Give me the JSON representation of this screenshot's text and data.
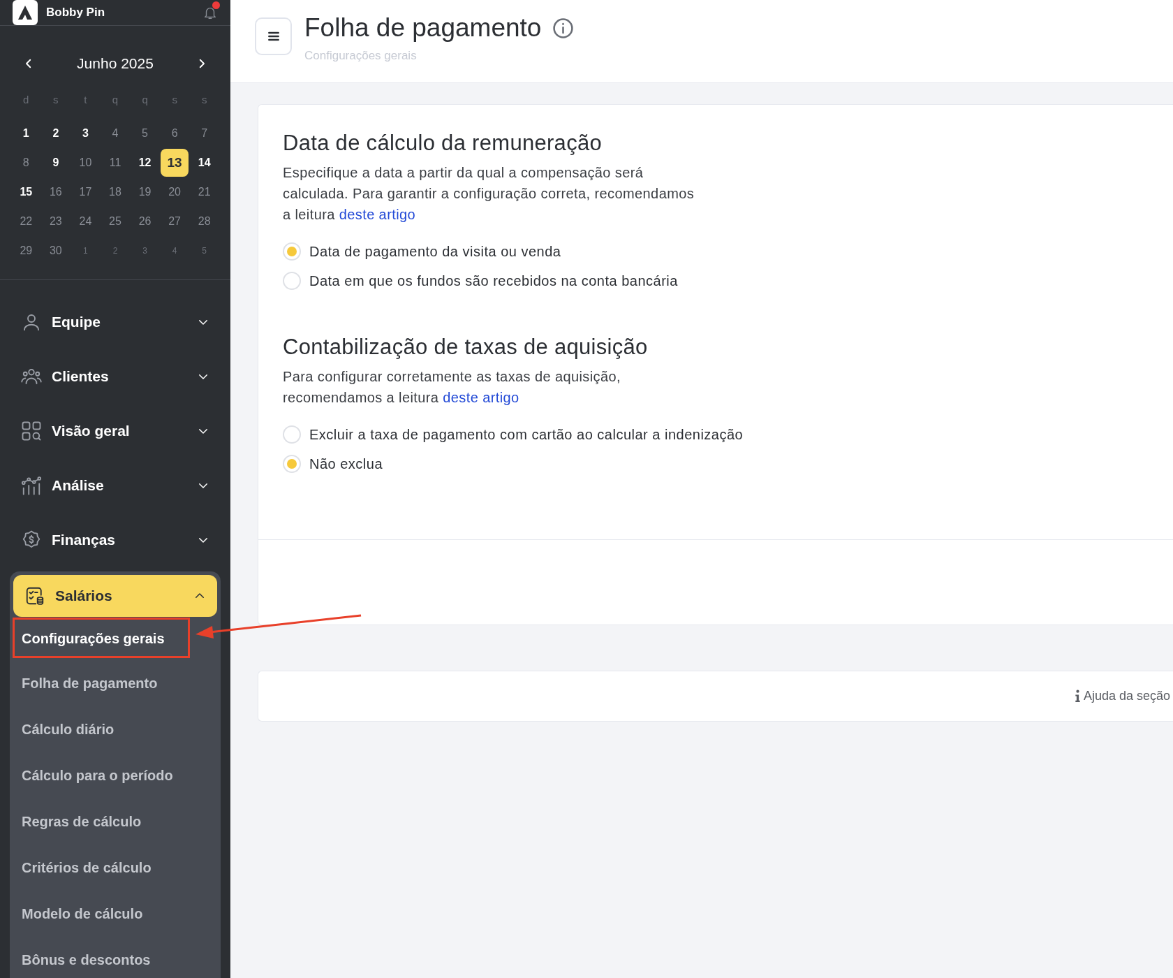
{
  "sidebar": {
    "user": {
      "name": "Bobby Pin",
      "has_notification": true
    },
    "calendar": {
      "month": "Junho 2025",
      "weekdays": [
        "d",
        "s",
        "t",
        "q",
        "q",
        "s",
        "s"
      ],
      "weeks": [
        [
          {
            "day": "1",
            "kind": "bold",
            "selected": false
          },
          {
            "day": "2",
            "kind": "bold",
            "selected": false
          },
          {
            "day": "3",
            "kind": "bold",
            "selected": false
          },
          {
            "day": "4",
            "kind": "normal",
            "selected": false
          },
          {
            "day": "5",
            "kind": "normal",
            "selected": false
          },
          {
            "day": "6",
            "kind": "normal",
            "selected": false
          },
          {
            "day": "7",
            "kind": "normal",
            "selected": false
          }
        ],
        [
          {
            "day": "8",
            "kind": "normal",
            "selected": false
          },
          {
            "day": "9",
            "kind": "bold",
            "selected": false
          },
          {
            "day": "10",
            "kind": "normal",
            "selected": false
          },
          {
            "day": "11",
            "kind": "normal",
            "selected": false
          },
          {
            "day": "12",
            "kind": "bold",
            "selected": false
          },
          {
            "day": "13",
            "kind": "bold",
            "selected": true
          },
          {
            "day": "14",
            "kind": "bold",
            "selected": false
          }
        ],
        [
          {
            "day": "15",
            "kind": "bold",
            "selected": false
          },
          {
            "day": "16",
            "kind": "normal",
            "selected": false
          },
          {
            "day": "17",
            "kind": "normal",
            "selected": false
          },
          {
            "day": "18",
            "kind": "normal",
            "selected": false
          },
          {
            "day": "19",
            "kind": "normal",
            "selected": false
          },
          {
            "day": "20",
            "kind": "normal",
            "selected": false
          },
          {
            "day": "21",
            "kind": "normal",
            "selected": false
          }
        ],
        [
          {
            "day": "22",
            "kind": "normal",
            "selected": false
          },
          {
            "day": "23",
            "kind": "normal",
            "selected": false
          },
          {
            "day": "24",
            "kind": "normal",
            "selected": false
          },
          {
            "day": "25",
            "kind": "normal",
            "selected": false
          },
          {
            "day": "26",
            "kind": "normal",
            "selected": false
          },
          {
            "day": "27",
            "kind": "normal",
            "selected": false
          },
          {
            "day": "28",
            "kind": "normal",
            "selected": false
          }
        ],
        [
          {
            "day": "29",
            "kind": "normal",
            "selected": false
          },
          {
            "day": "30",
            "kind": "normal",
            "selected": false
          },
          {
            "day": "1",
            "kind": "other",
            "selected": false
          },
          {
            "day": "2",
            "kind": "other",
            "selected": false
          },
          {
            "day": "3",
            "kind": "other",
            "selected": false
          },
          {
            "day": "4",
            "kind": "other",
            "selected": false
          },
          {
            "day": "5",
            "kind": "other",
            "selected": false
          }
        ]
      ]
    },
    "items": [
      {
        "label": "Equipe",
        "expanded": false
      },
      {
        "label": "Clientes",
        "expanded": false
      },
      {
        "label": "Visão geral",
        "expanded": false
      },
      {
        "label": "Análise",
        "expanded": false
      },
      {
        "label": "Finanças",
        "expanded": false
      },
      {
        "label": "Salários",
        "expanded": true,
        "children": [
          {
            "label": "Configurações gerais",
            "selected": true
          },
          {
            "label": "Folha de pagamento",
            "selected": false
          },
          {
            "label": "Cálculo diário",
            "selected": false
          },
          {
            "label": "Cálculo para o período",
            "selected": false
          },
          {
            "label": "Regras de cálculo",
            "selected": false
          },
          {
            "label": "Critérios de cálculo",
            "selected": false
          },
          {
            "label": "Modelo de cálculo",
            "selected": false
          },
          {
            "label": "Bônus e descontos",
            "selected": false
          }
        ]
      }
    ]
  },
  "header": {
    "title": "Folha de pagamento",
    "subtitle": "Configurações gerais"
  },
  "sections": [
    {
      "title": "Data de cálculo da remuneração",
      "description": "Especifique a data a partir da qual a compensação será calculada. Para garantir a configuração correta, recomendamos a leitura",
      "link": "deste artigo",
      "options": [
        {
          "label": "Data de pagamento da visita ou venda",
          "selected": true
        },
        {
          "label": "Data em que os fundos são recebidos na conta bancária",
          "selected": false
        }
      ]
    },
    {
      "title": "Contabilização de taxas de aquisição",
      "description": "Para configurar corretamente as taxas de aquisição, recomendamos a leitura",
      "link": "deste artigo",
      "options": [
        {
          "label": "Excluir a taxa de pagamento com cartão ao calcular a indenização",
          "selected": false
        },
        {
          "label": "Não exclua",
          "selected": true
        }
      ]
    }
  ],
  "help": {
    "label": "Ajuda da seção"
  }
}
